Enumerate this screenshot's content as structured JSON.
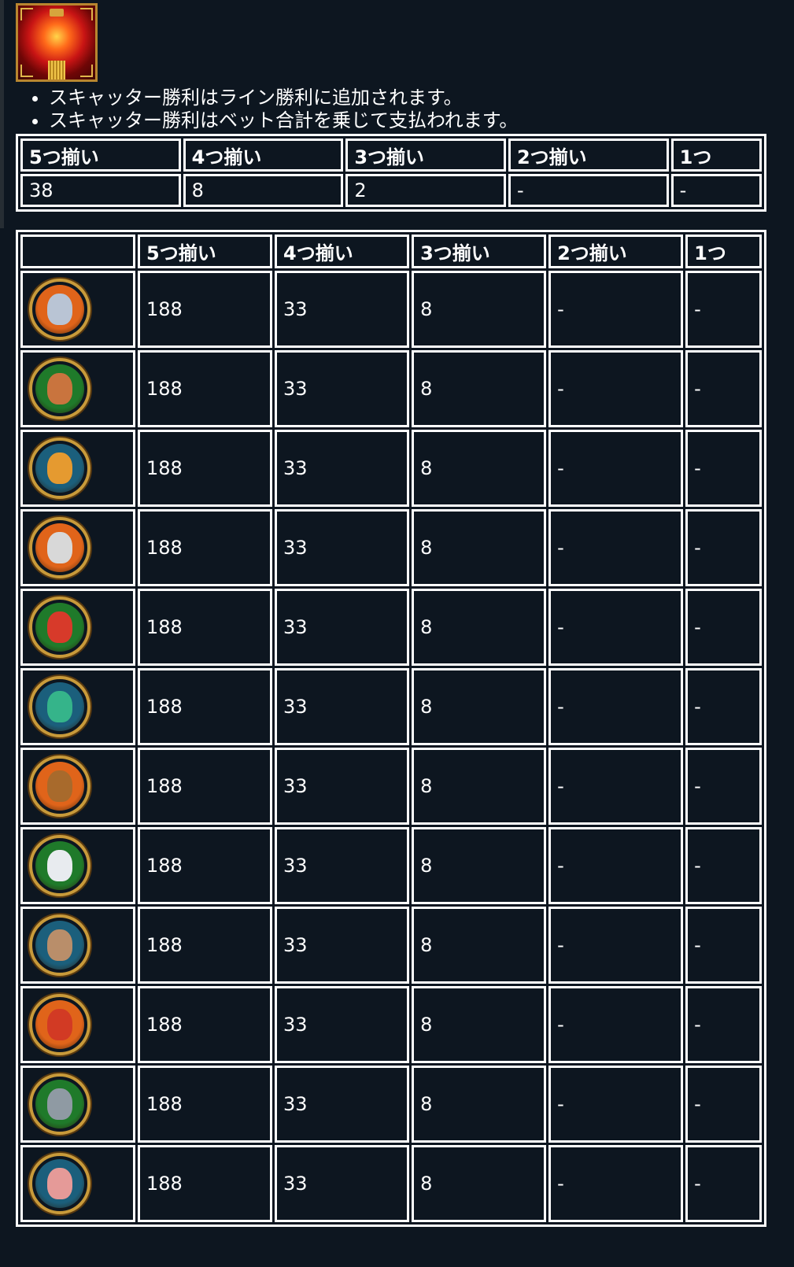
{
  "scatter": {
    "icon": "red-lantern-scatter-icon",
    "notes": [
      "スキャッター勝利はライン勝利に追加されます。",
      "スキャッター勝利はベット合計を乗じて支払われます。"
    ],
    "headers": [
      "5つ揃い",
      "4つ揃い",
      "3つ揃い",
      "2つ揃い",
      "1つ"
    ],
    "values": [
      "38",
      "8",
      "2",
      "-",
      "-"
    ]
  },
  "paytable": {
    "headers": [
      "",
      "5つ揃い",
      "4つ揃い",
      "3つ揃い",
      "2つ揃い",
      "1つ"
    ],
    "rows": [
      {
        "symbol": "rat-icon",
        "ring": "#e0641a",
        "face": "#b9c4d4",
        "values": [
          "188",
          "33",
          "8",
          "-",
          "-"
        ]
      },
      {
        "symbol": "ox-icon",
        "ring": "#1f7a2a",
        "face": "#c9743e",
        "values": [
          "188",
          "33",
          "8",
          "-",
          "-"
        ]
      },
      {
        "symbol": "tiger-icon",
        "ring": "#1b5f7c",
        "face": "#e59a30",
        "values": [
          "188",
          "33",
          "8",
          "-",
          "-"
        ]
      },
      {
        "symbol": "rabbit-icon",
        "ring": "#e0641a",
        "face": "#d8d8d8",
        "values": [
          "188",
          "33",
          "8",
          "-",
          "-"
        ]
      },
      {
        "symbol": "dragon-icon",
        "ring": "#1f7a2a",
        "face": "#d73a2a",
        "values": [
          "188",
          "33",
          "8",
          "-",
          "-"
        ]
      },
      {
        "symbol": "snake-icon",
        "ring": "#1b5f7c",
        "face": "#35b48a",
        "values": [
          "188",
          "33",
          "8",
          "-",
          "-"
        ]
      },
      {
        "symbol": "horse-icon",
        "ring": "#e0641a",
        "face": "#a86a2c",
        "values": [
          "188",
          "33",
          "8",
          "-",
          "-"
        ]
      },
      {
        "symbol": "goat-icon",
        "ring": "#1f7a2a",
        "face": "#e8ebef",
        "values": [
          "188",
          "33",
          "8",
          "-",
          "-"
        ]
      },
      {
        "symbol": "monkey-icon",
        "ring": "#1b5f7c",
        "face": "#b98e6a",
        "values": [
          "188",
          "33",
          "8",
          "-",
          "-"
        ]
      },
      {
        "symbol": "rooster-icon",
        "ring": "#e0641a",
        "face": "#d23a24",
        "values": [
          "188",
          "33",
          "8",
          "-",
          "-"
        ]
      },
      {
        "symbol": "dog-icon",
        "ring": "#1f7a2a",
        "face": "#8f9aa3",
        "values": [
          "188",
          "33",
          "8",
          "-",
          "-"
        ]
      },
      {
        "symbol": "pig-icon",
        "ring": "#1b5f7c",
        "face": "#e59a98",
        "values": [
          "188",
          "33",
          "8",
          "-",
          "-"
        ]
      }
    ]
  }
}
